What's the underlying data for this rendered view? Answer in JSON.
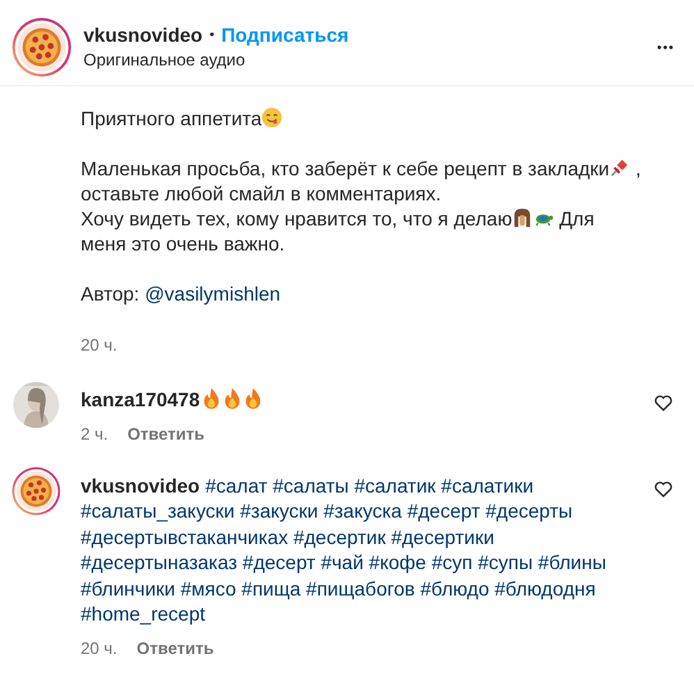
{
  "header": {
    "username": "vkusnovideo",
    "separator": "•",
    "follow": "Подписаться",
    "subtitle": "Оригинальное аудио",
    "more": "•••"
  },
  "caption": {
    "paragraphs": [
      [
        {
          "kind": "text",
          "text": "Приятного аппетита"
        },
        {
          "kind": "smiley"
        }
      ],
      [
        {
          "kind": "text",
          "text": "Маленькая просьба, кто заберёт к себе рецепт в закладки"
        },
        {
          "kind": "pushpin"
        },
        {
          "kind": "text",
          "text": " ,"
        },
        {
          "kind": "break"
        },
        {
          "kind": "text",
          "text": "оставьте любой смайл в комментариях."
        },
        {
          "kind": "break"
        },
        {
          "kind": "text",
          "text": "Хочу видеть тех, кому нравится то, что я делаю"
        },
        {
          "kind": "figure"
        },
        {
          "kind": "turtle"
        },
        {
          "kind": "text",
          "text": " Для"
        },
        {
          "kind": "break"
        },
        {
          "kind": "text",
          "text": "меня это очень важно."
        }
      ],
      [
        {
          "kind": "text",
          "text": "Автор: "
        },
        {
          "kind": "link",
          "text": "@vasilymishlen"
        }
      ]
    ],
    "time": "20 ч."
  },
  "comments": [
    {
      "username": "kanza170478",
      "reactions": [
        {
          "kind": "fire"
        },
        {
          "kind": "fire"
        },
        {
          "kind": "fire"
        }
      ],
      "time": "2 ч.",
      "reply": "Ответить"
    },
    {
      "kind": "pizza",
      "username": "vkusnovideo",
      "text_lines": [
        "#салат #салаты #салатик #салатики",
        "#салаты_закуски #закуски #закуска #десерт #десерты",
        "#десертывстаканчиках #десертик #десертики",
        "#десертыназаказ #десерт #чай #кофе #суп #супы #блины",
        "#блинчики #мясо #пища #пищабогов #блюдо #блюдодня",
        "#home_recept"
      ],
      "time": "20 ч.",
      "reply": "Ответить"
    }
  ]
}
